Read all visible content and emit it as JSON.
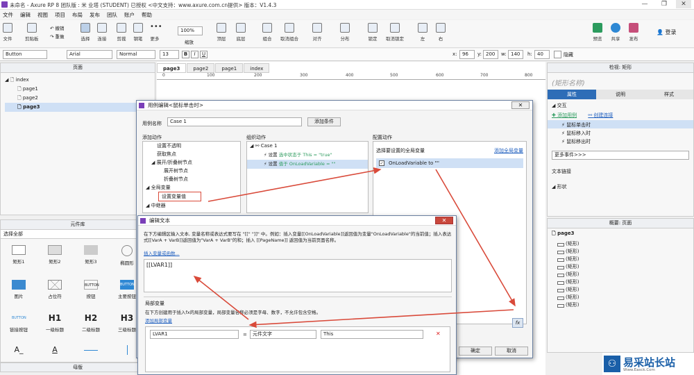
{
  "window": {
    "title": "未命名 - Axure RP 8 团队版 : 米 业塔 (STUDENT) 已授权   <中文支持：www.axure.com.cn提供> 版本：V1.4.3",
    "min": "—",
    "max": "❐",
    "close": "✕"
  },
  "menu": [
    "文件",
    "编辑",
    "视图",
    "项目",
    "布局",
    "发布",
    "团队",
    "账户",
    "帮助"
  ],
  "toolbar": {
    "file": "文件",
    "clipboard": "剪贴板",
    "undo": "撤销",
    "redo": "重做",
    "select": "选择",
    "connect": "连接",
    "pen": "钢笔",
    "more": "更多",
    "zoom_value": "100%",
    "zoom_label": "缩放",
    "top": "顶层",
    "bottom": "底层",
    "group": "组合",
    "ungroup": "取消组合",
    "align": "对齐",
    "distribute": "分布",
    "lock": "锁定",
    "unlock": "取消锁定",
    "left": "左",
    "right": "右",
    "preview": "预览",
    "share": "共享",
    "publish": "发布",
    "login": "登录"
  },
  "format": {
    "style_value": "Button",
    "font_value": "Arial",
    "weight_value": "Normal",
    "size_value": "13",
    "x_label": "x:",
    "x_value": "96",
    "y_label": "y:",
    "y_value": "200",
    "w_label": "w:",
    "w_value": "140",
    "h_label": "h:",
    "h_value": "40",
    "hide_label": "隐藏",
    "bold": "B",
    "italic": "I",
    "underline": "U"
  },
  "pages_panel": {
    "title": "页面",
    "items": [
      "index",
      "page1",
      "page2",
      "page3"
    ]
  },
  "widgets_panel": {
    "title": "元件库",
    "select": "选择全部",
    "items": [
      "矩形1",
      "矩形2",
      "矩形3",
      "椭圆形",
      "图片",
      "占位符",
      "按钮",
      "主要按钮",
      "链接按钮",
      "一级标题",
      "二级标题",
      "三级标题"
    ],
    "thumb_button": "BUTTON",
    "h1": "H1",
    "h2": "H2",
    "h3": "H3"
  },
  "masters_panel": {
    "title": "母版"
  },
  "canvas": {
    "tabs": [
      "page3",
      "page2",
      "page1",
      "index"
    ],
    "ruler": [
      "0",
      "100",
      "200",
      "300",
      "400",
      "500",
      "600",
      "700",
      "800"
    ]
  },
  "inspector": {
    "title": "检视: 矩形",
    "name_placeholder": "(矩形名称)",
    "tabs": [
      "属性",
      "说明",
      "样式"
    ],
    "interaction": "交互",
    "add_case": "添加用例",
    "create_link": "创建连接",
    "events": [
      "鼠标单击时",
      "鼠标移入时",
      "鼠标移出时"
    ],
    "more_events": "更多事件>>>",
    "text_link": "文本链接",
    "shape": "形状"
  },
  "outline": {
    "title": "概要: 页面",
    "page": "page3",
    "items": [
      "(矩形)",
      "(矩形)",
      "(矩形)",
      "(矩形)",
      "(矩形)",
      "(矩形)",
      "(矩形)",
      "(矩形)",
      "(矩形)"
    ]
  },
  "case_editor": {
    "title": "用例编辑<鼠标单击时>",
    "case_name_label": "用例名称",
    "case_name_value": "Case 1",
    "add_condition": "添加条件",
    "add_action": "添加动作",
    "organize_action": "组织动作",
    "config_action": "配置动作",
    "actions": [
      "设置不透明",
      "获取焦点",
      "展开/折叠树节点",
      "展开树节点",
      "折叠树节点",
      "全局变量",
      "设置变量值",
      "中继器"
    ],
    "case": "Case 1",
    "org_items": [
      {
        "verb": "设置",
        "detail": "选中状态于 This = \"true\""
      },
      {
        "verb": "设置",
        "detail": "值于 OnLoadVariable = \"\""
      }
    ],
    "config_title": "选择要设置的全局变量",
    "add_global": "添加全局变量",
    "global_var": "OnLoadVariable to \"\"",
    "fx": "fx",
    "ok": "确定",
    "cancel": "取消"
  },
  "edit_text": {
    "title": "编辑文本",
    "close": "✕",
    "desc": "在下方编辑区输入文本, 变量名称或表达式要写在 \"[[\" \"]]\" 中。例如：插入变量[[OnLoadVariable]]返回值为变量\"OnLoadVariable\"的当前值；插入表达式[[VarA + VarB]]返回值为\"VarA + VarB\"的和；插入 [[PageName]] 返回值为当前页面名称。",
    "insert_link": "插入变量或函数...",
    "text_value": "[[LVAR1]]",
    "local_title": "局部变量",
    "local_desc": "在下方创建用于插入fx的局部变量，局部变量名称必须是字母、数字，不允许包含空格。",
    "add_local": "添加局部变量",
    "var_name": "LVAR1",
    "equals": "=",
    "var_type": "元件文字",
    "var_target": "This",
    "delete": "✕"
  },
  "watermark": {
    "brand": "易采站长站",
    "sub": "Www.Easck.Com"
  },
  "colors": {
    "accent": "#1f5fbf",
    "arrow": "#d94a3a",
    "logo": "#7a3fb8",
    "sel": "#cfe0f5"
  }
}
